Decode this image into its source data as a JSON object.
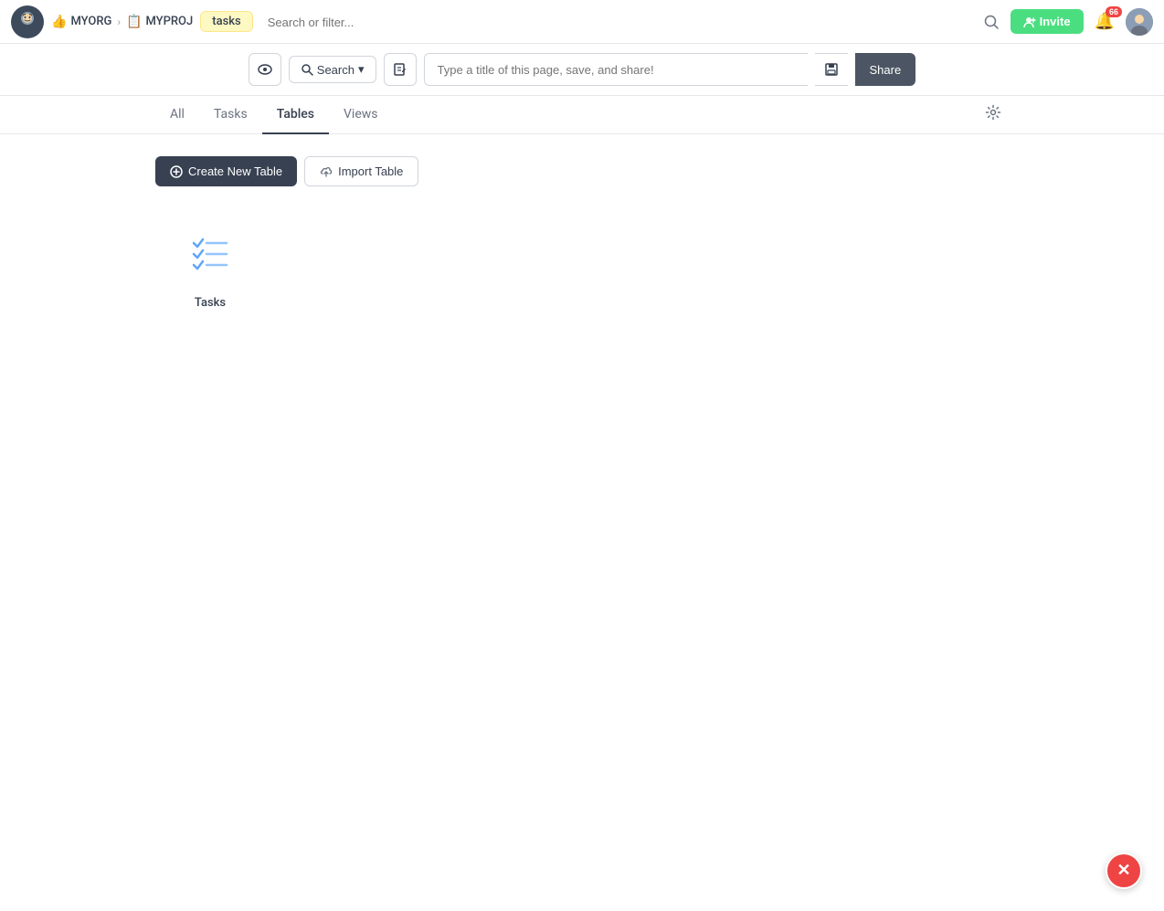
{
  "navbar": {
    "org_label": "MYORG",
    "proj_label": "MYPROJ",
    "table_pill": "tasks",
    "search_placeholder": "Search or filter...",
    "invite_label": "Invite",
    "notification_count": "66",
    "chevron": "›"
  },
  "toolbar": {
    "search_label": "Search",
    "title_placeholder": "Type a title of this page, save, and share!",
    "share_label": "Share"
  },
  "tabs": {
    "items": [
      {
        "label": "All",
        "active": false
      },
      {
        "label": "Tasks",
        "active": false
      },
      {
        "label": "Tables",
        "active": true
      },
      {
        "label": "Views",
        "active": false
      }
    ]
  },
  "actions": {
    "create_label": "Create New Table",
    "import_label": "Import Table"
  },
  "tables": [
    {
      "label": "Tasks"
    }
  ]
}
